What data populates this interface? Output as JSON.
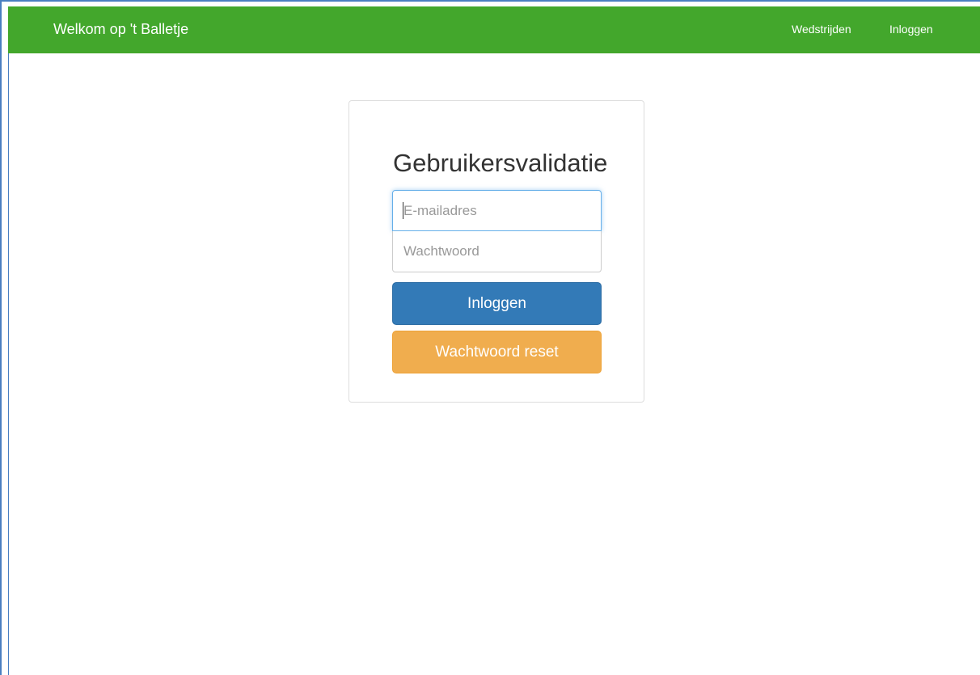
{
  "navbar": {
    "brand": "Welkom op 't Balletje",
    "links": [
      "Wedstrijden",
      "Inloggen"
    ],
    "color": "#43a72c"
  },
  "login": {
    "title": "Gebruikersvalidatie",
    "email_placeholder": "E-mailadres",
    "email_value": "",
    "password_placeholder": "Wachtwoord",
    "password_value": "",
    "login_button": "Inloggen",
    "reset_button": "Wachtwoord reset",
    "login_color": "#337ab7",
    "reset_color": "#f0ad4e"
  }
}
